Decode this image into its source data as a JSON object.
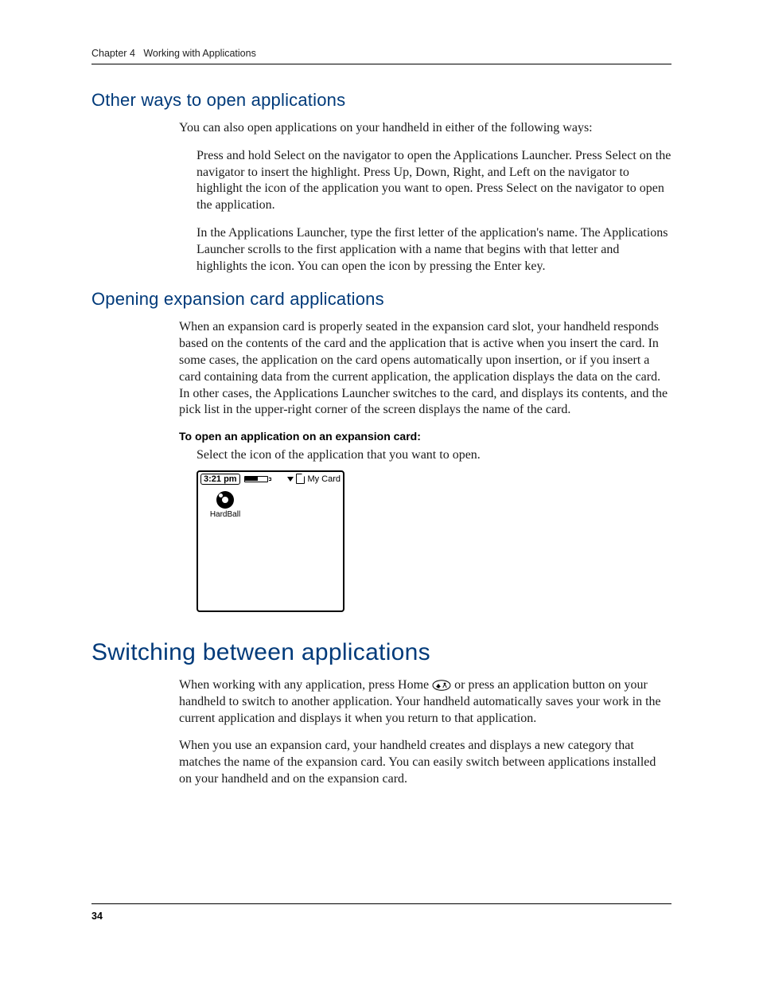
{
  "header": {
    "chapter": "Chapter 4",
    "title": "Working with Applications"
  },
  "section1": {
    "heading": "Other ways to open applications",
    "intro": "You can also open applications on your handheld in either of the following ways:",
    "para1": "Press and hold Select on the navigator to open the Applications Launcher. Press Select on the navigator to insert the highlight. Press Up, Down, Right, and Left on the navigator to highlight the icon of the application you want to open. Press Select on the navigator to open the application.",
    "para2": "In the Applications Launcher, type the first letter of the application's name. The Applications Launcher scrolls to the first application with a name that begins with that letter and highlights the icon. You can open the icon by pressing the Enter key."
  },
  "section2": {
    "heading": "Opening expansion card applications",
    "para1": "When an expansion card is properly seated in the expansion card slot, your handheld responds based on the contents of the card and the application that is active when you insert the card. In some cases, the application on the card opens automatically upon insertion, or if you insert a card containing data from the current application, the application displays the data on the card. In other cases, the Applications Launcher switches to the card, and displays its contents, and the pick list in the upper-right corner of the screen displays the name of the card.",
    "procedure": "To open an application on an expansion card:",
    "step": "Select the icon of the application that you want to open."
  },
  "screenshot": {
    "time": "3:21 pm",
    "category_label": "My Card",
    "app_name": "HardBall"
  },
  "section3": {
    "heading": "Switching between applications",
    "para1a": "When working with any application, press Home ",
    "para1b": " or press an application button on your handheld to switch to another application. Your handheld automatically saves your work in the current application and displays it when you return to that application.",
    "para2": "When you use an expansion card, your handheld creates and displays a new category that matches the name of the expansion card. You can easily switch between applications installed on your handheld and on the expansion card."
  },
  "footer": {
    "page": "34"
  }
}
